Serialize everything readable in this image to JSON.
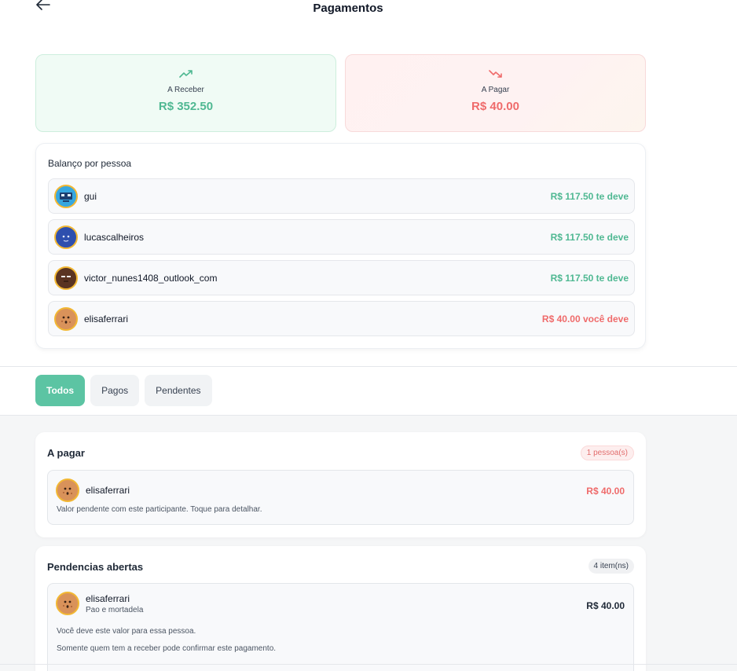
{
  "header": {
    "title": "Pagamentos",
    "back_icon": "arrow-left-icon"
  },
  "summary": {
    "receive": {
      "icon": "trending-up-icon",
      "label": "A Receber",
      "value": "R$ 352.50",
      "color": "#4fb892"
    },
    "pay": {
      "icon": "trending-down-icon",
      "label": "A Pagar",
      "value": "R$ 40.00",
      "color": "#ef6b6b"
    }
  },
  "balance": {
    "title": "Balanço por pessoa",
    "people": [
      {
        "name": "gui",
        "amount": "R$ 117.50 te deve",
        "status": "positive",
        "avatar": "robot-avatar"
      },
      {
        "name": "lucascalheiros",
        "amount": "R$ 117.50 te deve",
        "status": "positive",
        "avatar": "blue-avatar"
      },
      {
        "name": "victor_nunes1408_outlook_com",
        "amount": "R$ 117.50 te deve",
        "status": "positive",
        "avatar": "dark-avatar"
      },
      {
        "name": "elisaferrari",
        "amount": "R$ 40.00 você deve",
        "status": "negative",
        "avatar": "cookie-avatar"
      }
    ]
  },
  "tabs": [
    {
      "label": "Todos",
      "active": true
    },
    {
      "label": "Pagos",
      "active": false
    },
    {
      "label": "Pendentes",
      "active": false
    }
  ],
  "a_pagar": {
    "title": "A pagar",
    "badge": "1 pessoa(s)",
    "item": {
      "name": "elisaferrari",
      "amount": "R$ 40.00",
      "description": "Valor pendente com este participante. Toque para detalhar."
    }
  },
  "pendencias": {
    "title": "Pendencias abertas",
    "badge": "4 item(ns)",
    "item": {
      "name": "elisaferrari",
      "subtitle": "Pao e mortadela",
      "amount": "R$ 40.00",
      "line1": "Você deve este valor para essa pessoa.",
      "line2": "Somente quem tem a receber pode confirmar este pagamento."
    }
  },
  "colors": {
    "accent": "#5cc4a3",
    "positive": "#4fb892",
    "negative": "#ef6b6b",
    "avatar_border": "#f2b733"
  }
}
